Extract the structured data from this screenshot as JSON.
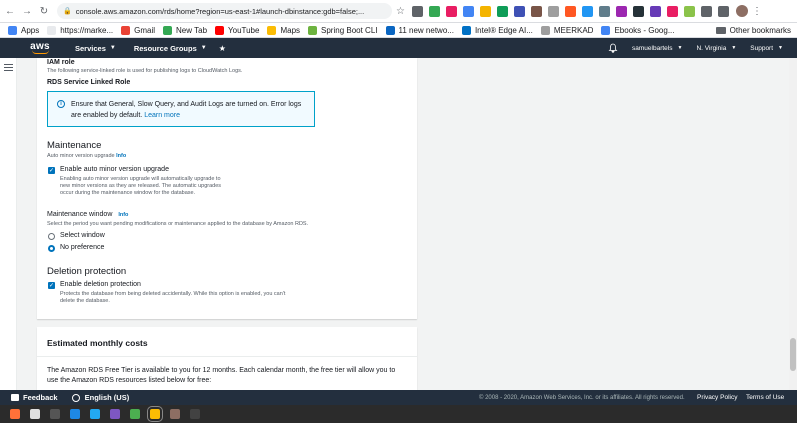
{
  "browser": {
    "url": "console.aws.amazon.com/rds/home?region=us-east-1#launch-dbinstance:gdb=false;...",
    "bookmarks": [
      {
        "label": "Apps",
        "color": "#4285f4"
      },
      {
        "label": "https://marke...",
        "color": "#e8eaed"
      },
      {
        "label": "Gmail",
        "color": "#ea4335"
      },
      {
        "label": "New Tab",
        "color": "#34a853"
      },
      {
        "label": "YouTube",
        "color": "#ff0000"
      },
      {
        "label": "Maps",
        "color": "#fbbc04"
      },
      {
        "label": "Spring Boot CLI",
        "color": "#6db33f"
      },
      {
        "label": "11 new netwo...",
        "color": "#0a66c2"
      },
      {
        "label": "Intel® Edge AI...",
        "color": "#0071c5"
      },
      {
        "label": "MEERKAD",
        "color": "#9e9e9e"
      },
      {
        "label": "Ebooks - Goog...",
        "color": "#4285f4"
      }
    ],
    "other_bookmarks": "Other bookmarks"
  },
  "header": {
    "logo": "aws",
    "services": "Services",
    "resource_groups": "Resource Groups",
    "user": "samuelbartels",
    "region": "N. Virginia",
    "support": "Support"
  },
  "iam": {
    "title": "IAM role",
    "desc": "The following service-linked role is used for publishing logs to CloudWatch Logs.",
    "role_name": "RDS Service Linked Role",
    "info_text": "Ensure that General, Slow Query, and Audit Logs are turned on. Error logs are enabled by default.",
    "learn_more": "Learn more"
  },
  "maintenance": {
    "title": "Maintenance",
    "sublabel": "Auto minor version upgrade",
    "info": "Info",
    "checkbox_label": "Enable auto minor version upgrade",
    "checkbox_desc_1": "Enabling auto minor version upgrade will automatically upgrade to",
    "checkbox_desc_2": "new minor versions as they are released. The automatic upgrades",
    "checkbox_desc_3": "occur during the maintenance window for the database.",
    "window_title": "Maintenance window",
    "window_info": "Info",
    "window_desc": "Select the period you want pending modifications or maintenance applied to the database by Amazon RDS.",
    "option_select": "Select window",
    "option_none": "No preference"
  },
  "deletion": {
    "title": "Deletion protection",
    "checkbox_label": "Enable deletion protection",
    "desc_1": "Protects the database from being deleted accidentally. While this option is enabled, you can't",
    "desc_2": "delete the database."
  },
  "costs": {
    "title": "Estimated monthly costs",
    "text_1": "The Amazon RDS Free Tier is available to you for 12 months. Each calendar month, the free tier will allow you to",
    "text_2": "use the Amazon RDS resources listed below for free:"
  },
  "footer": {
    "feedback": "Feedback",
    "language": "English (US)",
    "copyright": "© 2008 - 2020, Amazon Web Services, Inc. or its affiliates. All rights reserved.",
    "privacy": "Privacy Policy",
    "terms": "Terms of Use"
  },
  "taskbar": {
    "icons": [
      "firefox-icon",
      "files-icon",
      "terminal-icon",
      "settings-icon",
      "vscode-icon",
      "photos-icon",
      "chart-icon",
      "chrome-icon",
      "gimp-icon",
      "monitor-icon"
    ],
    "colors": [
      "#ff7139",
      "#e0e0e0",
      "#555555",
      "#1e88e5",
      "#23a9f2",
      "#7e57c2",
      "#4caf50",
      "#fbbc04",
      "#8d6e63",
      "#424242"
    ]
  },
  "colors": {
    "aws_navy": "#232f3e",
    "aws_orange": "#ff9900",
    "accent_blue": "#0073bb"
  }
}
